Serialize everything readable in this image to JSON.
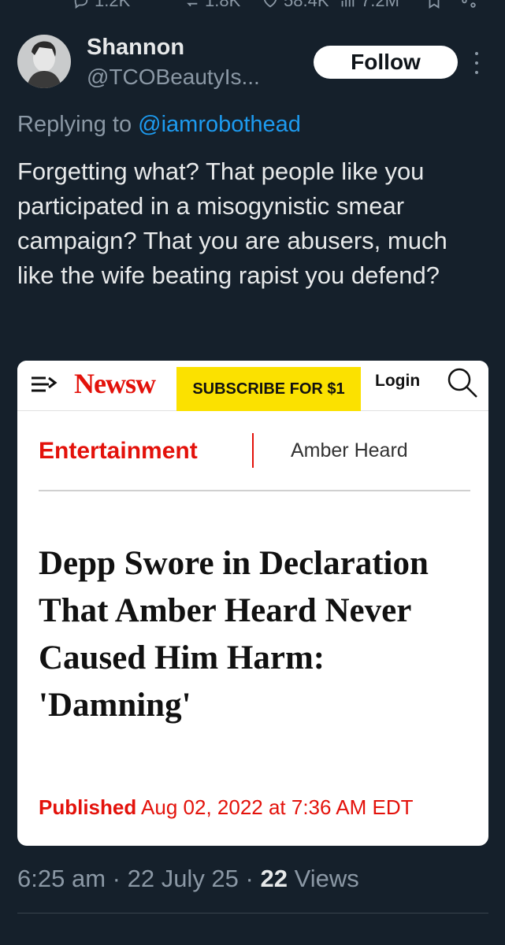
{
  "top_actions": {
    "replies": "1.2K",
    "reposts": "1.8K",
    "likes": "58.4K",
    "views": "7.2M"
  },
  "post": {
    "author_name": "Shannon",
    "author_handle": "@TCOBeautyIs...",
    "follow_label": "Follow",
    "replying_prefix": "Replying to",
    "replying_to": "@iamrobothead",
    "text": "Forgetting what? That people like you participated in a misogynistic smear campaign? That you are abusers, much like the wife beating rapist you defend?",
    "time": "6:25 am",
    "date": "22 July 25",
    "views_count": "22",
    "views_label": "Views"
  },
  "article": {
    "logo": "Newsw",
    "subscribe_label": "SUBSCRIBE FOR $1",
    "login_label": "Login",
    "section": "Entertainment",
    "tag": "Amber Heard",
    "headline": "Depp Swore in Declaration That Amber Heard Never Caused Him Harm: 'Damning'",
    "published_label": "Published",
    "published_date": "Aug 02, 2022 at 7:36 AM EDT"
  },
  "colors": {
    "background": "#15202b",
    "accent": "#1d9bf0",
    "newsweek_red": "#e3120b",
    "subscribe_yellow": "#fbe100"
  }
}
